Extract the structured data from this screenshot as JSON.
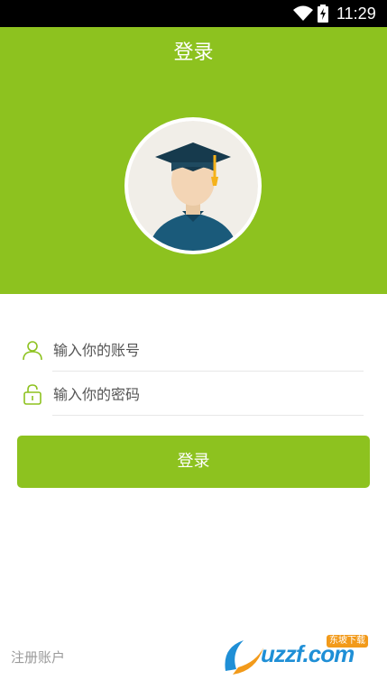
{
  "status_bar": {
    "time": "11:29"
  },
  "header": {
    "title": "登录"
  },
  "form": {
    "account_placeholder": "输入你的账号",
    "password_placeholder": "输入你的密码",
    "login_label": "登录"
  },
  "footer": {
    "register_label": "注册账户"
  },
  "watermark": {
    "brand": "uzzf.com",
    "tag": "东坡下载"
  },
  "icons": {
    "wifi": "wifi-icon",
    "battery": "battery-charging-icon",
    "avatar": "graduate-avatar",
    "user": "user-icon",
    "lock": "lock-icon"
  },
  "colors": {
    "accent": "#8dc21f",
    "status_bar": "#000000",
    "avatar_shirt": "#1a5a7a",
    "tassel": "#f5b21b"
  }
}
